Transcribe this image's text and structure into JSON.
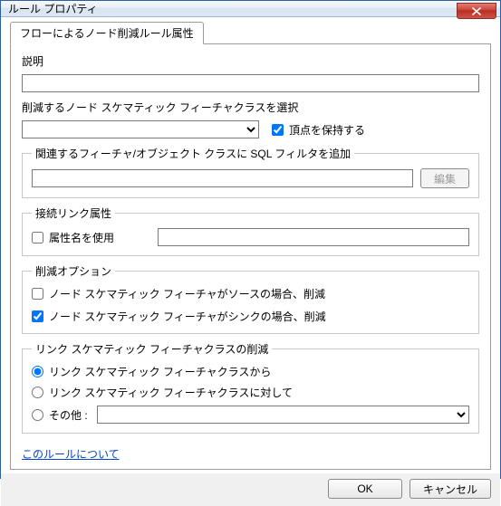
{
  "window": {
    "title": "ルール プロパティ"
  },
  "tab": {
    "label": "フローによるノード削減ルール属性"
  },
  "description": {
    "label": "説明"
  },
  "featureClass": {
    "label": "削減するノード スケマティック フィーチャクラスを選択",
    "keepVerticesLabel": "頂点を保持する"
  },
  "sqlFilter": {
    "legend": "関連するフィーチャ/オブジェクト クラスに SQL フィルタを追加",
    "editLabel": "編集"
  },
  "connection": {
    "legend": "接続リンク属性",
    "useAttrNameLabel": "属性名を使用"
  },
  "reduceOptions": {
    "legend": "削減オプション",
    "sourceLabel": "ノード スケマティック フィーチャがソースの場合、削減",
    "sinkLabel": "ノード スケマティック フィーチャがシンクの場合、削減"
  },
  "linkReduce": {
    "legend": "リンク スケマティック フィーチャクラスの削減",
    "fromLabel": "リンク スケマティック フィーチャクラスから",
    "againstLabel": "リンク スケマティック フィーチャクラスに対して",
    "otherLabel": "その他 :"
  },
  "aboutLink": "このルールについて",
  "buttons": {
    "ok": "OK",
    "cancel": "キャンセル"
  }
}
